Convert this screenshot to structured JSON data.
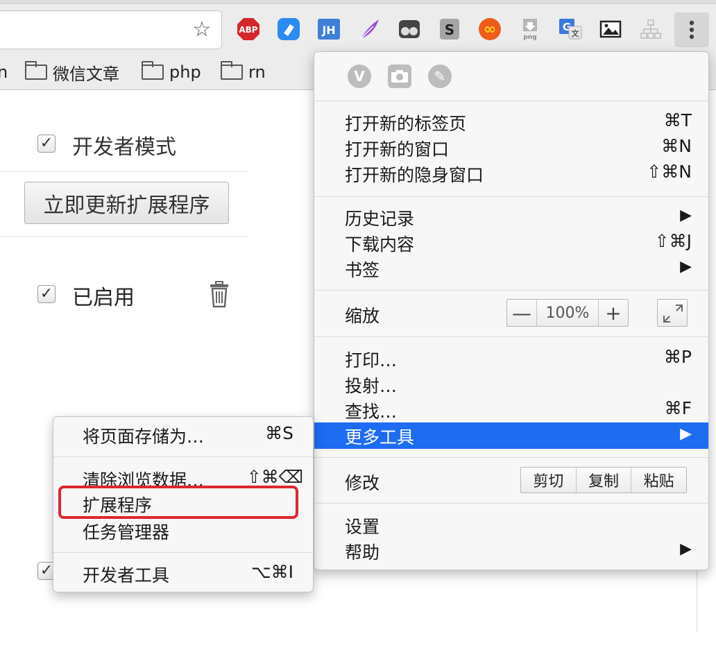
{
  "bookmarks_bar": {
    "items": [
      {
        "label": "n"
      },
      {
        "label": "微信文章"
      },
      {
        "label": "php"
      },
      {
        "label": "rn"
      }
    ]
  },
  "extensions": [
    {
      "name": "abp-icon",
      "text": "ABP",
      "color": "#d6262b"
    },
    {
      "name": "tag-icon",
      "text": "",
      "color": "#2a8bf2"
    },
    {
      "name": "jh-icon",
      "text": "JH",
      "color": "#3e7fd8"
    },
    {
      "name": "feather-icon",
      "text": "",
      "color": "#8a3fd1"
    },
    {
      "name": "glasses-icon",
      "text": "",
      "color": "#444444"
    },
    {
      "name": "s-icon",
      "text": "S",
      "color": "#9a9a9a"
    },
    {
      "name": "infinity-icon",
      "text": "∞",
      "color": "#f05a1a"
    },
    {
      "name": "png-download-icon",
      "text": "png",
      "color": "#9a9a9a"
    },
    {
      "name": "translate-icon",
      "text": "G",
      "color": "#3a79e0"
    },
    {
      "name": "image-icon",
      "text": "",
      "color": "#222222"
    },
    {
      "name": "sitemap-icon",
      "text": "",
      "color": "#bbbbbb"
    }
  ],
  "page": {
    "developer_mode_label": "开发者模式",
    "update_button": "立即更新扩展程序",
    "enabled_label": "已启用"
  },
  "main_menu": {
    "new_tab": {
      "label": "打开新的标签页",
      "shortcut": "⌘T"
    },
    "new_window": {
      "label": "打开新的窗口",
      "shortcut": "⌘N"
    },
    "new_incognito": {
      "label": "打开新的隐身窗口",
      "shortcut": "⇧⌘N"
    },
    "history": {
      "label": "历史记录"
    },
    "downloads": {
      "label": "下载内容",
      "shortcut": "⇧⌘J"
    },
    "bookmarks": {
      "label": "书签"
    },
    "zoom": {
      "label": "缩放",
      "minus": "—",
      "value": "100%",
      "plus": "+"
    },
    "print": {
      "label": "打印…",
      "shortcut": "⌘P"
    },
    "cast": {
      "label": "投射…"
    },
    "find": {
      "label": "查找…",
      "shortcut": "⌘F"
    },
    "more_tools": {
      "label": "更多工具"
    },
    "edit": {
      "label": "修改",
      "cut": "剪切",
      "copy": "复制",
      "paste": "粘贴"
    },
    "settings": {
      "label": "设置"
    },
    "help": {
      "label": "帮助"
    },
    "arrow": "▶",
    "highlight_color": "#1d6cf2"
  },
  "sub_menu": {
    "save_page": {
      "label": "将页面存储为…",
      "shortcut": "⌘S"
    },
    "clear_data": {
      "label": "清除浏览数据…",
      "shortcut": "⇧⌘⌫"
    },
    "extensions": {
      "label": "扩展程序"
    },
    "task_manager": {
      "label": "任务管理器"
    },
    "dev_tools": {
      "label": "开发者工具",
      "shortcut": "⌥⌘I"
    }
  },
  "annotation": {
    "color": "#e0262f"
  }
}
